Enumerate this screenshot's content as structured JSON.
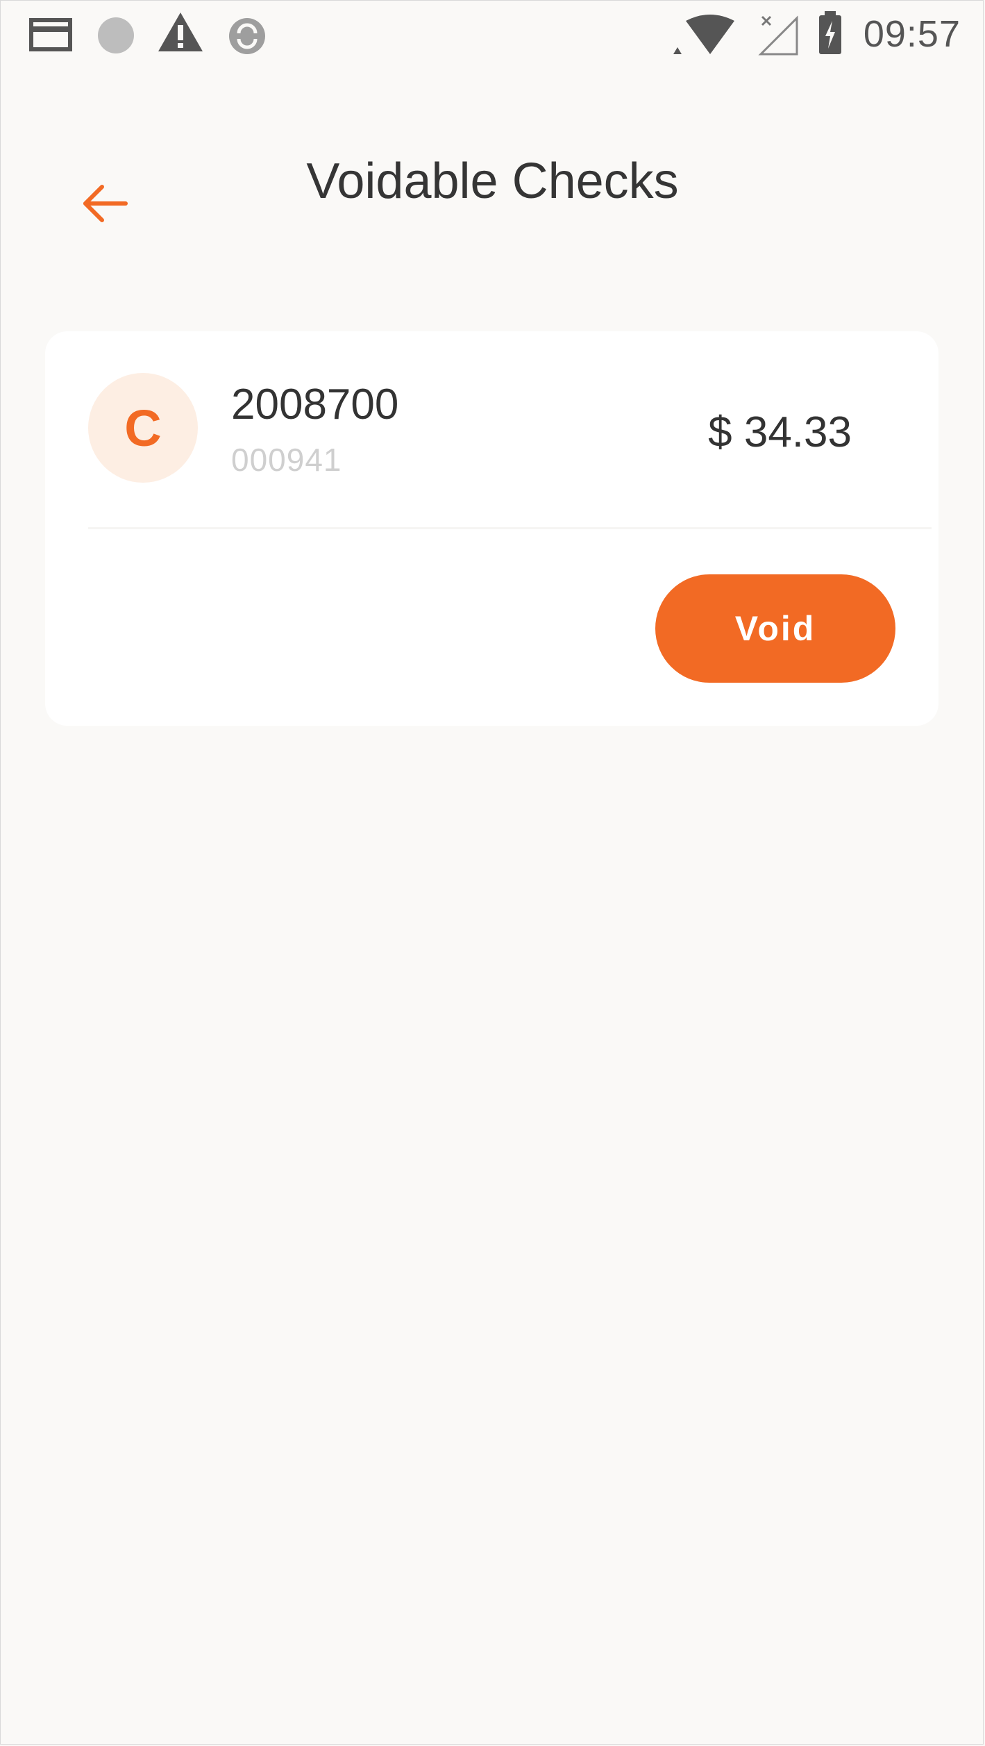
{
  "status_bar": {
    "time": "09:57",
    "left_icons": [
      "card-icon",
      "circle-icon",
      "warning-icon",
      "sync-icon"
    ],
    "right_icons": [
      "wifi-icon",
      "signal-off-icon",
      "battery-charging-icon"
    ]
  },
  "header": {
    "title": "Voidable Checks",
    "back_icon": "arrow-left-icon"
  },
  "checks": [
    {
      "avatar_letter": "C",
      "number": "2008700",
      "sub": "000941",
      "amount": "$ 34.33",
      "action_label": "Void"
    }
  ],
  "colors": {
    "accent": "#f26a24",
    "avatar_bg": "#fdeee3",
    "background": "#faf9f7",
    "card": "#ffffff",
    "title_text": "#353535",
    "secondary_text": "#cfcfcf"
  }
}
